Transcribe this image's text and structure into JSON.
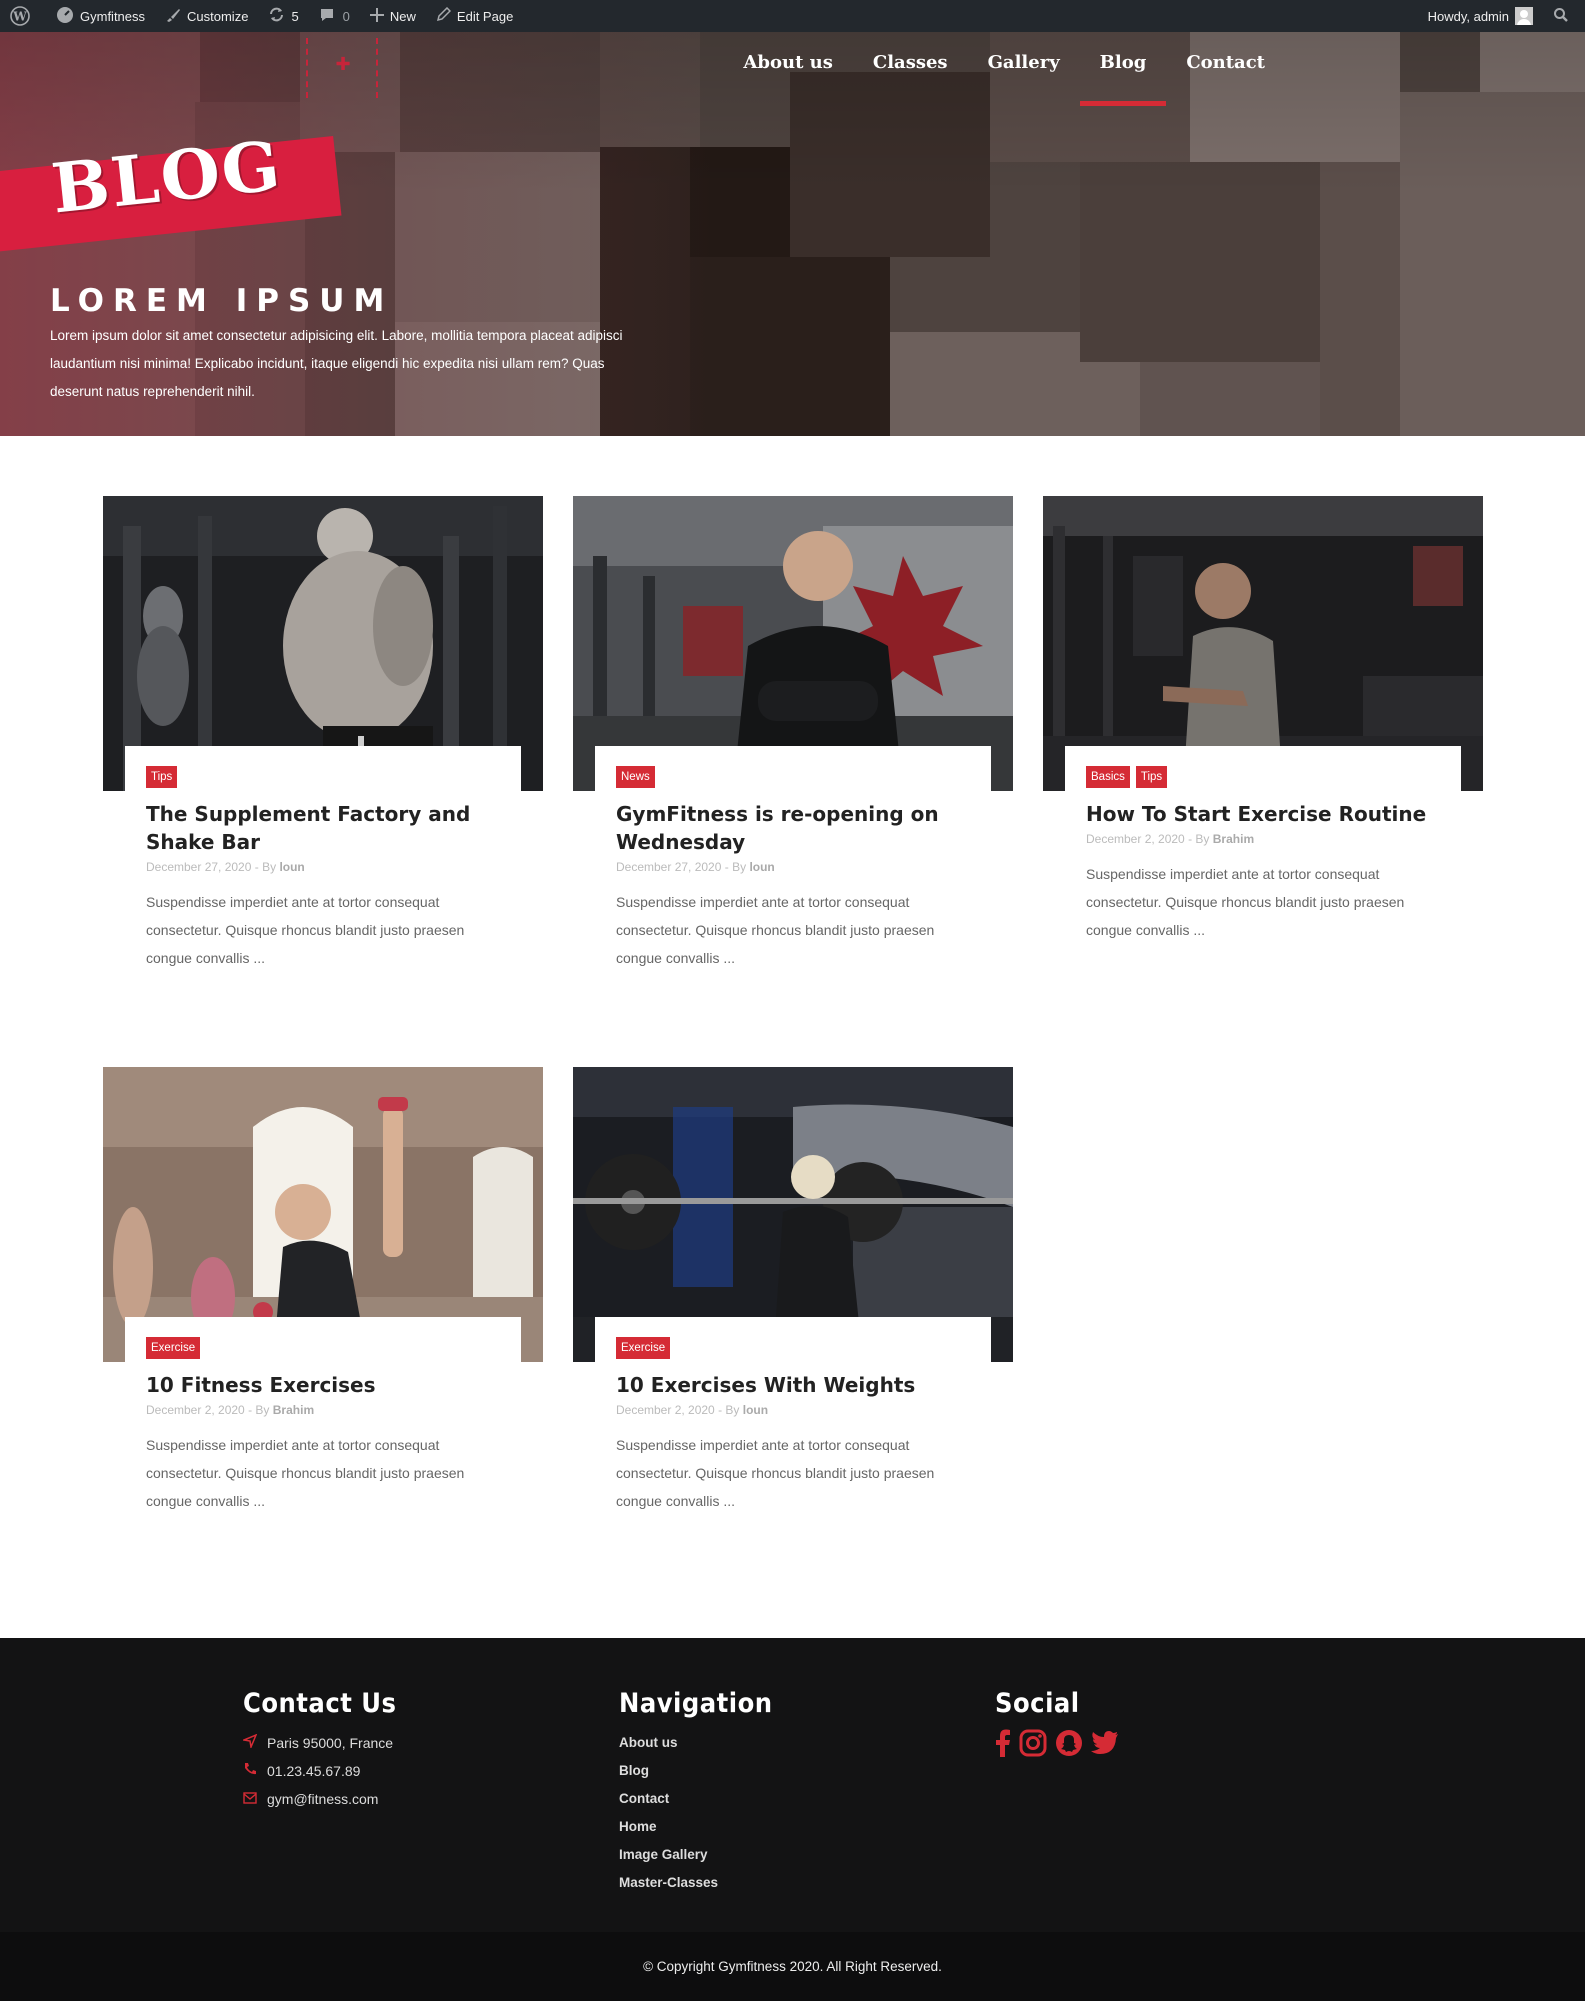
{
  "adminbar": {
    "site_name": "Gymfitness",
    "customize": "Customize",
    "updates_count": "5",
    "comments_count": "0",
    "new_label": "New",
    "edit_page": "Edit Page",
    "howdy": "Howdy, admin"
  },
  "header": {
    "nav": [
      {
        "label": "About us",
        "active": false
      },
      {
        "label": "Classes",
        "active": false
      },
      {
        "label": "Gallery",
        "active": false
      },
      {
        "label": "Blog",
        "active": true
      },
      {
        "label": "Contact",
        "active": false
      }
    ],
    "banner_word": "BLOG",
    "hero_title": "LOREM IPSUM",
    "hero_text": "Lorem ipsum dolor sit amet consectetur adipisicing elit. Labore, mollitia tempora placeat adipisci laudantium nisi minima! Explicabo incidunt, itaque eligendi hic expedita nisi ullam rem? Quas deserunt natus reprehenderit nihil."
  },
  "posts": [
    {
      "tags": [
        "Tips"
      ],
      "title": "The Supplement Factory and Shake Bar",
      "date": "December 27, 2020",
      "by": "- By",
      "author": "loun",
      "excerpt": "Suspendisse imperdiet ante at tortor consequat consectetur. Quisque rhoncus blandit justo praesen congue convallis ..."
    },
    {
      "tags": [
        "News"
      ],
      "title": "GymFitness is re-opening on Wednesday",
      "date": "December 27, 2020",
      "by": "- By",
      "author": "loun",
      "excerpt": "Suspendisse imperdiet ante at tortor consequat consectetur. Quisque rhoncus blandit justo praesen congue convallis ..."
    },
    {
      "tags": [
        "Basics",
        "Tips"
      ],
      "title": "How To Start Exercise Routine",
      "date": "December 2, 2020",
      "by": "- By",
      "author": "Brahim",
      "excerpt": "Suspendisse imperdiet ante at tortor consequat consectetur. Quisque rhoncus blandit justo praesen congue convallis ..."
    },
    {
      "tags": [
        "Exercise"
      ],
      "title": "10 Fitness Exercises",
      "date": "December 2, 2020",
      "by": "- By",
      "author": "Brahim",
      "excerpt": "Suspendisse imperdiet ante at tortor consequat consectetur. Quisque rhoncus blandit justo praesen congue convallis ..."
    },
    {
      "tags": [
        "Exercise"
      ],
      "title": "10 Exercises With Weights",
      "date": "December 2, 2020",
      "by": "- By",
      "author": "loun",
      "excerpt": "Suspendisse imperdiet ante at tortor consequat consectetur. Quisque rhoncus blandit justo praesen congue convallis ..."
    }
  ],
  "footer": {
    "contact_heading": "Contact Us",
    "address": "Paris 95000, France",
    "phone": "01.23.45.67.89",
    "email": "gym@fitness.com",
    "nav_heading": "Navigation",
    "nav_links": [
      "About us",
      "Blog",
      "Contact",
      "Home",
      "Image Gallery",
      "Master-Classes"
    ],
    "social_heading": "Social",
    "social_icons": [
      "facebook-icon",
      "instagram-icon",
      "snapchat-icon",
      "twitter-icon"
    ],
    "copyright": "© Copyright Gymfitness 2020. All Right Reserved."
  },
  "colors": {
    "accent": "#d52b35",
    "banner": "#d81f3f",
    "adminbar": "#23282d",
    "footer": "#131314"
  }
}
